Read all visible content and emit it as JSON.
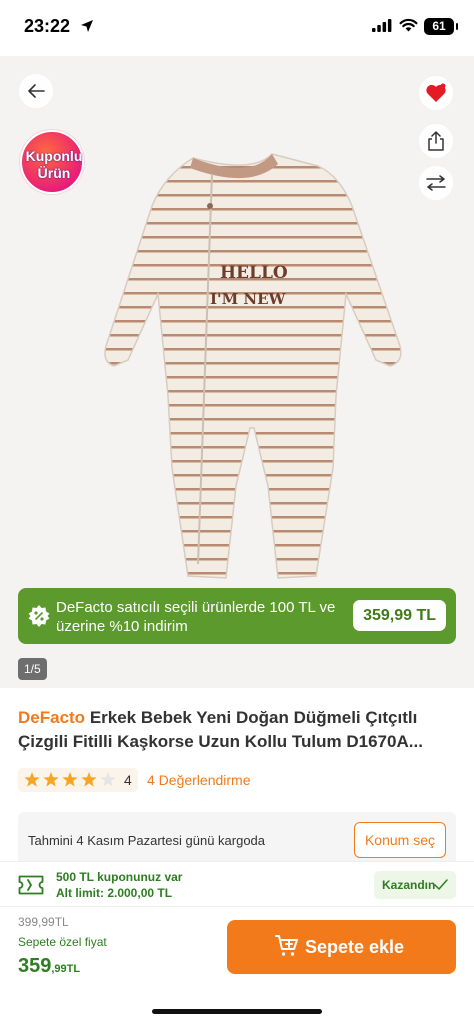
{
  "status_bar": {
    "time": "23:22",
    "battery": "61"
  },
  "gallery": {
    "coupon_badge": {
      "line1": "Kuponlu",
      "line2": "Ürün"
    },
    "promo": {
      "text": "DeFacto satıcılı seçili ürünlerde 100 TL ve üzerine %10 indirim",
      "price": "359,99 TL"
    },
    "page_indicator": "1/5",
    "print_text": {
      "line1": "HELLO",
      "line2": "I'M NEW"
    },
    "icons": [
      "back-arrow-icon",
      "heart-icon",
      "share-icon",
      "compare-arrows-icon"
    ]
  },
  "product": {
    "brand": "DeFacto",
    "title": "Erkek Bebek Yeni Doğan Düğmeli Çıtçıtlı Çizgili Fitilli Kaşkorse Uzun Kollu Tulum D1670A...",
    "rating_value": "4",
    "rating_count": "4 Değerlendirme",
    "rating_stars": 4,
    "rating_max": 5
  },
  "delivery": {
    "text": "Tahmini 4 Kasım Pazartesi günü kargoda",
    "button": "Konum seç"
  },
  "coupon": {
    "line1": "500 TL kuponunuz var",
    "line2": "Alt limit: 2.000,00 TL",
    "button": "Kazandın"
  },
  "footer": {
    "old_price": "399,99TL",
    "special_label": "Sepete özel fiyat",
    "price_int": "359",
    "price_dec": ",99TL",
    "cart_button": "Sepete ekle"
  },
  "colors": {
    "brand_orange": "#f27a1a",
    "promo_green": "#5c9a2e",
    "price_green": "#2e7d20",
    "star_gold": "#f5a623"
  }
}
